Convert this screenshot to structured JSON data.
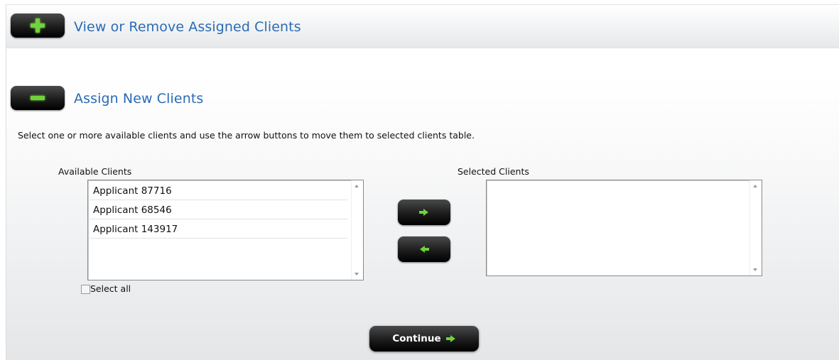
{
  "sections": {
    "view_remove": {
      "title": "View or Remove Assigned Clients",
      "toggle_icon": "plus-icon"
    },
    "assign_new": {
      "title": "Assign New Clients",
      "toggle_icon": "minus-icon"
    }
  },
  "instructions": "Select one or more available clients and use the arrow buttons to move them to selected clients table.",
  "available": {
    "label": "Available Clients",
    "items": [
      "Applicant 87716",
      "Applicant 68546",
      "Applicant 143917"
    ]
  },
  "selected": {
    "label": "Selected Clients",
    "items": []
  },
  "move_buttons": {
    "add_icon": "arrow-right-icon",
    "remove_icon": "arrow-left-icon"
  },
  "select_all": {
    "label": "Select all",
    "checked": false
  },
  "continue": {
    "label": "Continue",
    "icon": "arrow-right-icon"
  },
  "colors": {
    "title_blue": "#2a6bb5",
    "icon_green": "#6fd23a",
    "button_dark": "#1c1c1c"
  }
}
